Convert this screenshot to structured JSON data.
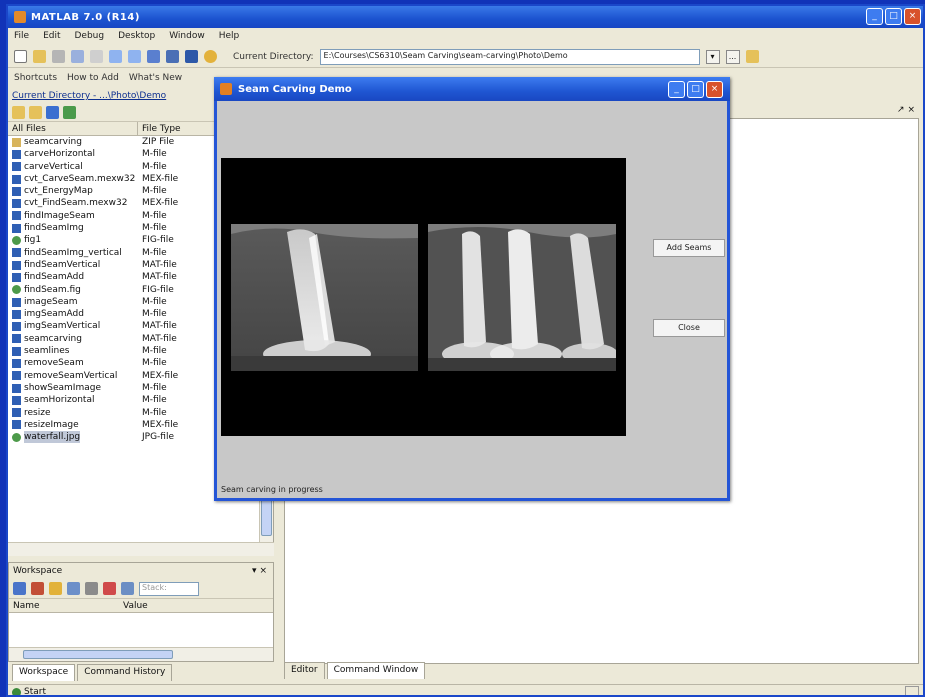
{
  "app": {
    "title": "MATLAB 7.0 (R14)",
    "window_buttons": [
      "_",
      "□",
      "×"
    ]
  },
  "menu": [
    "File",
    "Edit",
    "Debug",
    "Desktop",
    "Window",
    "Help"
  ],
  "toolbar": {
    "current_directory_label": "Current Directory:",
    "current_directory_value": "E:\\Courses\\CS6310\\Seam Carving\\seam-carving\\Photo\\Demo",
    "browse_label": "...",
    "shortcuts": [
      "Shortcuts",
      "How to Add",
      "What's New"
    ]
  },
  "current_directory": {
    "title": "Current Directory - ...\\Photo\\Demo",
    "col_name": "All Files",
    "col_type": "File Type",
    "files": [
      {
        "name": "seamcarving",
        "type": "ZIP File",
        "icon": "folder"
      },
      {
        "name": "carveHorizontal",
        "type": "M-file",
        "icon": "m"
      },
      {
        "name": "carveVertical",
        "type": "M-file",
        "icon": "m"
      },
      {
        "name": "cvt_CarveSeam.mexw32",
        "type": "MEX-file",
        "icon": "m"
      },
      {
        "name": "cvt_EnergyMap",
        "type": "M-file",
        "icon": "m"
      },
      {
        "name": "cvt_FindSeam.mexw32",
        "type": "MEX-file",
        "icon": "m"
      },
      {
        "name": "findImageSeam",
        "type": "M-file",
        "icon": "m"
      },
      {
        "name": "findSeamImg",
        "type": "M-file",
        "icon": "m"
      },
      {
        "name": "fig1",
        "type": "FIG-file",
        "icon": "i"
      },
      {
        "name": "findSeamImg_vertical",
        "type": "M-file",
        "icon": "m"
      },
      {
        "name": "findSeamVertical",
        "type": "MAT-file",
        "icon": "m"
      },
      {
        "name": "findSeamAdd",
        "type": "MAT-file",
        "icon": "m"
      },
      {
        "name": "findSeam.fig",
        "type": "FIG-file",
        "icon": "i"
      },
      {
        "name": "imageSeam",
        "type": "M-file",
        "icon": "m"
      },
      {
        "name": "imgSeamAdd",
        "type": "M-file",
        "icon": "m"
      },
      {
        "name": "imgSeamVertical",
        "type": "MAT-file",
        "icon": "m"
      },
      {
        "name": "seamcarving",
        "type": "MAT-file",
        "icon": "m"
      },
      {
        "name": "seamlines",
        "type": "M-file",
        "icon": "m"
      },
      {
        "name": "removeSeam",
        "type": "M-file",
        "icon": "m"
      },
      {
        "name": "removeSeamVertical",
        "type": "MEX-file",
        "icon": "m"
      },
      {
        "name": "showSeamImage",
        "type": "M-file",
        "icon": "m"
      },
      {
        "name": "seamHorizontal",
        "type": "M-file",
        "icon": "m"
      },
      {
        "name": "resize",
        "type": "M-file",
        "icon": "m"
      },
      {
        "name": "resizeImage",
        "type": "MEX-file",
        "icon": "m"
      },
      {
        "name": "waterfall.jpg",
        "type": "JPG-file",
        "icon": "i"
      }
    ]
  },
  "workspace": {
    "title": "Workspace",
    "close_labels": [
      "▾",
      "×"
    ],
    "select_placeholder": "Stack:",
    "col_name": "Name",
    "col_value": "Value"
  },
  "left_tabs": [
    "Workspace",
    "Command History"
  ],
  "right_tabs": [
    "Editor",
    "Command Window"
  ],
  "right_ctrl": "↗ ×",
  "status": {
    "start": "Start"
  },
  "figure": {
    "title": "Seam Carving Demo",
    "buttons": {
      "add": "Add Seams",
      "close": "Close"
    },
    "status": "Seam carving in progress"
  },
  "colors": {
    "desktop_blue": "#1133b8",
    "title_blue": "#1b52cf",
    "figure_bg": "#c8c8c8"
  }
}
